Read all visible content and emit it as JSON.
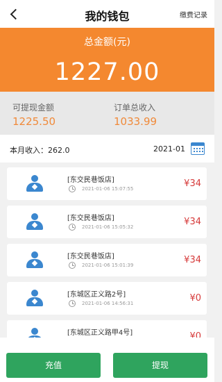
{
  "header": {
    "title": "我的钱包",
    "records_link": "缴费记录"
  },
  "balance": {
    "label": "总金额(元)",
    "amount": "1227.00"
  },
  "stats": {
    "withdrawable_label": "可提现金额",
    "withdrawable_value": "1225.50",
    "order_income_label": "订单总收入",
    "order_income_value": "1033.99"
  },
  "month": {
    "income_text": "本月收入：262.0",
    "date": "2021-01"
  },
  "records": [
    {
      "name": "[东交民巷饭店]",
      "time": "2021-01-06 15:07:55",
      "amount": "¥34"
    },
    {
      "name": "[东交民巷饭店]",
      "time": "2021-01-06 15:05:32",
      "amount": "¥34"
    },
    {
      "name": "[东交民巷饭店]",
      "time": "2021-01-06 15:01:39",
      "amount": "¥34"
    },
    {
      "name": "[东城区正义路2号]",
      "time": "2021-01-06 14:56:31",
      "amount": "¥0"
    },
    {
      "name": "[东城区正义路甲4号]",
      "time": "",
      "amount": "¥0"
    }
  ],
  "footer": {
    "recharge_label": "充值",
    "withdraw_label": "提现"
  },
  "colors": {
    "accent_orange": "#f4882f",
    "button_green": "#2fa45e",
    "icon_blue": "#3b87cf",
    "amount_red": "#d63a3a"
  }
}
